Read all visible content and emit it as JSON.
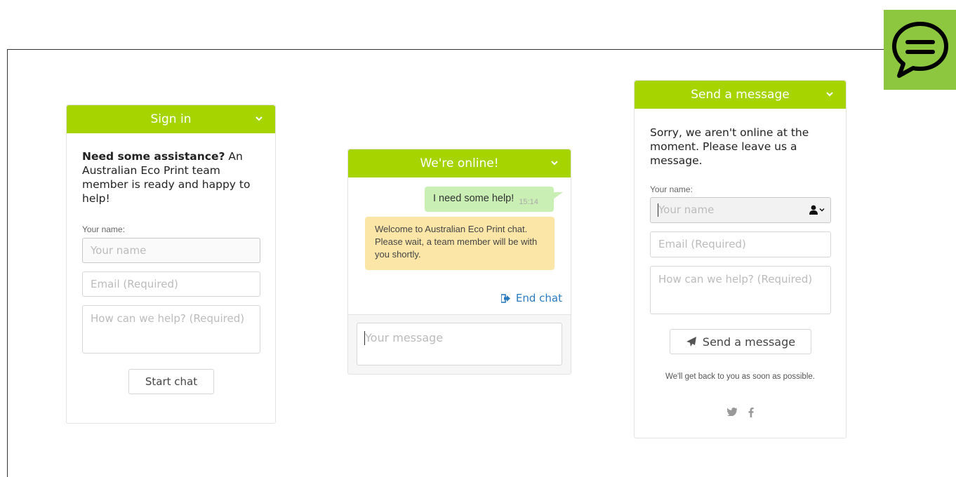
{
  "signin": {
    "header": "Sign in",
    "intro_bold": "Need some assistance?",
    "intro_rest": " An Australian Eco Print team member is ready and happy to help!",
    "name_label": "Your name:",
    "name_placeholder": "Your name",
    "email_placeholder": "Email (Required)",
    "help_placeholder": "How can we help? (Required)",
    "start_button": "Start chat"
  },
  "online": {
    "header": "We're online!",
    "user_message": "I need some help!",
    "user_time": "15:14",
    "agent_message": "Welcome to Australian Eco Print chat. Please wait, a team member will be with you shortly.",
    "end_chat": "End chat",
    "message_placeholder": "Your message"
  },
  "offline": {
    "header": "Send a message",
    "intro": "Sorry, we aren't online at the moment. Please leave us a message.",
    "name_label": "Your name:",
    "name_placeholder": "Your name",
    "email_placeholder": "Email (Required)",
    "help_placeholder": "How can we help? (Required)",
    "send_button": "Send a message",
    "footer_note": "We'll get back to you as soon as possible."
  },
  "colors": {
    "header_green": "#a6d400",
    "fab_green": "#8dc63f",
    "user_bubble": "#c9efb4",
    "agent_bubble": "#fbe6a8",
    "link_blue": "#2a7ac0"
  },
  "icons": [
    "chat-bubble-icon",
    "chevron-down-icon",
    "sign-out-icon",
    "user-icon",
    "paper-plane-icon",
    "twitter-icon",
    "facebook-icon"
  ]
}
